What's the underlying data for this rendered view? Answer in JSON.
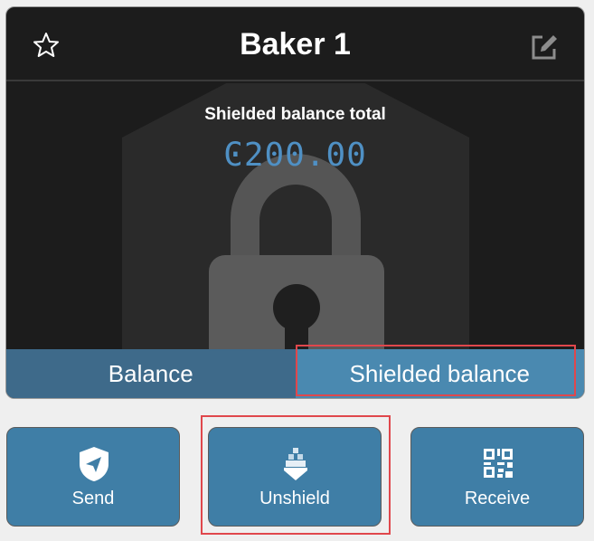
{
  "account": {
    "title": "Baker 1",
    "shielded_label": "Shielded balance total",
    "shielded_value": "Ͼ200.00"
  },
  "tabs": [
    {
      "label": "Balance",
      "active": false
    },
    {
      "label": "Shielded balance",
      "active": true
    }
  ],
  "actions": [
    {
      "label": "Send",
      "icon": "send-shield-icon"
    },
    {
      "label": "Unshield",
      "icon": "unshield-icon"
    },
    {
      "label": "Receive",
      "icon": "qr-code-icon"
    }
  ],
  "icons": {
    "favorite": "star-outline-icon",
    "edit": "edit-icon",
    "background": "padlock-shield-icon"
  },
  "colors": {
    "card_bg": "#1c1c1c",
    "accent_value": "#4f90c4",
    "tab_inactive": "#3e6a8a",
    "tab_active": "#4a89b0",
    "action_bg": "#3f7ea6",
    "highlight": "#e0474c"
  }
}
